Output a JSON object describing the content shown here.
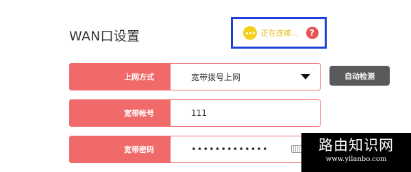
{
  "header": {
    "title": "WAN口设置"
  },
  "status": {
    "text": "正在连接...",
    "help_symbol": "?",
    "dot_color": "#f4cf1e",
    "text_color": "#e8b80f",
    "help_color": "#e85454",
    "highlight_border_color": "#1e3fd8"
  },
  "form": {
    "connection_type": {
      "label": "上网方式",
      "value": "宽带拨号上网"
    },
    "account": {
      "label": "宽带帐号",
      "value": "111"
    },
    "password": {
      "label": "宽带密码",
      "value": "•••••••••••••"
    },
    "accent_color": "#f06a6a"
  },
  "actions": {
    "auto_detect_label": "自动检测"
  },
  "watermark": {
    "title": "路由知识网",
    "url": "www.yilanbo.com"
  }
}
